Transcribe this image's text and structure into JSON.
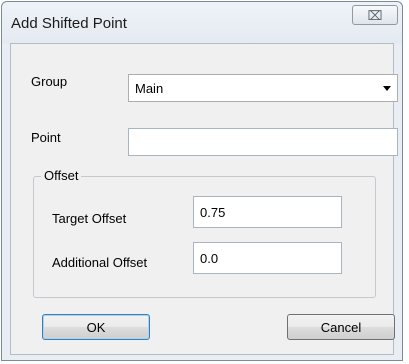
{
  "window": {
    "title": "Add Shifted Point",
    "close_glyph": "⌧"
  },
  "form": {
    "group_label": "Group",
    "group_value": "Main",
    "point_label": "Point",
    "point_value": "",
    "offset_group_label": "Offset",
    "target_offset_label": "Target Offset",
    "target_offset_value": "0.75",
    "additional_offset_label": "Additional Offset",
    "additional_offset_value": "0.0"
  },
  "buttons": {
    "ok_label": "OK",
    "cancel_label": "Cancel"
  },
  "icons": {
    "close": "close-icon",
    "dropdown": "chevron-down-icon"
  },
  "colors": {
    "title_bg": "#e9eef4",
    "client_bg": "#f0f0f0",
    "input_border": "#a9b5c2",
    "ok_focus_border": "#3c7fb1"
  }
}
